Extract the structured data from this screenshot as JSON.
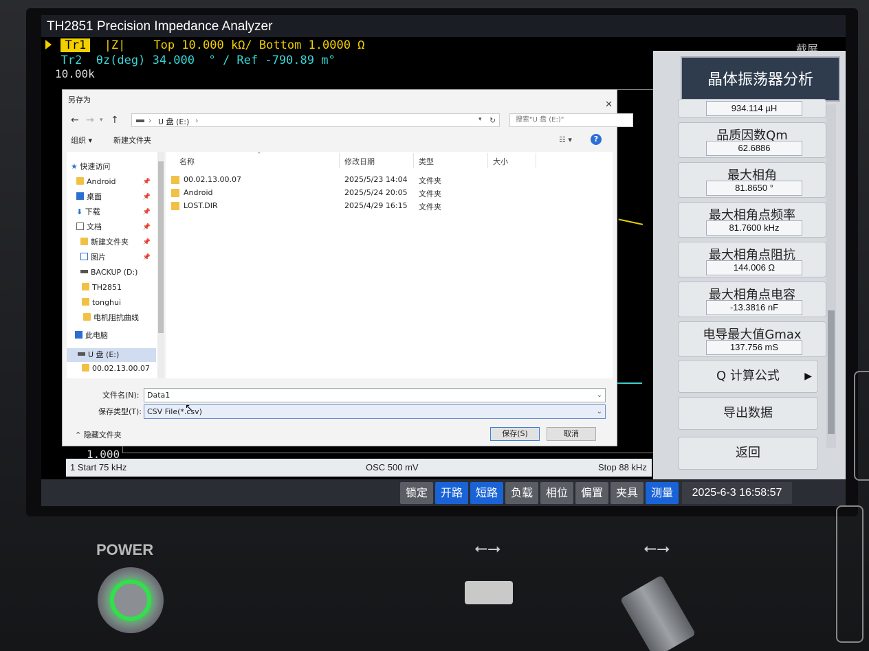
{
  "app": {
    "title": "TH2851 Precision Impedance Analyzer",
    "screenshot_label": "截屏"
  },
  "traces": {
    "tr1": {
      "tag": "Tr1",
      "param": "|Z|",
      "text": "Top 10.000 kΩ/ Bottom 1.0000 Ω"
    },
    "tr2": {
      "tag": "Tr2",
      "param": "θz(deg)",
      "text": "34.000  ° / Ref -790.89 m°"
    }
  },
  "scale": {
    "top": "10.00k",
    "bottom": "1.000"
  },
  "status": {
    "start": "1  Start  75 kHz",
    "osc": "OSC 500 mV",
    "stop": "Stop  88 kHz"
  },
  "panel": {
    "title": "晶体振荡器分析",
    "top_value": "934.114 µH",
    "rows": [
      {
        "label": "品质因数Qm",
        "value": "62.6886"
      },
      {
        "label": "最大相角",
        "value": "81.8650 °"
      },
      {
        "label": "最大相角点频率",
        "value": "81.7600 kHz"
      },
      {
        "label": "最大相角点阻抗",
        "value": "144.006 Ω"
      },
      {
        "label": "最大相角点电容",
        "value": "-13.3816 nF"
      },
      {
        "label": "电导最大值Gmax",
        "value": "137.756 mS"
      }
    ],
    "q_formula": "Q 计算公式",
    "export": "导出数据",
    "back": "返回"
  },
  "softkeys": [
    "锁定",
    "开路",
    "短路",
    "负载",
    "相位",
    "偏置",
    "夹具",
    "测量"
  ],
  "datetime": "2025-6-3 16:58:57",
  "dialog": {
    "title": "另存为",
    "address": {
      "drive_icon": "drive-icon",
      "path": "U 盘 (E:)"
    },
    "search_placeholder": "搜索\"U 盘 (E:)\"",
    "organize": "组织 ▾",
    "new_folder": "新建文件夹",
    "columns": {
      "name": "名称",
      "modified": "修改日期",
      "type": "类型",
      "size": "大小"
    },
    "nav": [
      {
        "label": "快速访问",
        "icon": "star-icon"
      },
      {
        "label": "Android",
        "icon": "folder-icon"
      },
      {
        "label": "桌面",
        "icon": "desktop-icon"
      },
      {
        "label": "下载",
        "icon": "download-icon"
      },
      {
        "label": "文档",
        "icon": "document-icon"
      },
      {
        "label": "新建文件夹",
        "icon": "folder-icon"
      },
      {
        "label": "图片",
        "icon": "pictures-icon"
      },
      {
        "label": "BACKUP (D:)",
        "icon": "drive-icon"
      },
      {
        "label": "TH2851",
        "icon": "folder-icon"
      },
      {
        "label": "tonghui",
        "icon": "folder-icon"
      },
      {
        "label": "电机阻抗曲线",
        "icon": "folder-icon"
      },
      {
        "label": "此电脑",
        "icon": "computer-icon"
      },
      {
        "label": "U 盘 (E:)",
        "icon": "drive-icon"
      },
      {
        "label": "00.02.13.00.07",
        "icon": "folder-icon"
      }
    ],
    "files": [
      {
        "name": "00.02.13.00.07",
        "modified": "2025/5/23 14:04",
        "type": "文件夹"
      },
      {
        "name": "Android",
        "modified": "2025/5/24 20:05",
        "type": "文件夹"
      },
      {
        "name": "LOST.DIR",
        "modified": "2025/4/29 16:15",
        "type": "文件夹"
      }
    ],
    "filename_label": "文件名(N):",
    "filename_value": "Data1",
    "filetype_label": "保存类型(T):",
    "filetype_value": "CSV File(*.csv)",
    "hide_folders": "隐藏文件夹",
    "save": "保存(S)",
    "cancel": "取消"
  },
  "hardware": {
    "power_label": "POWER"
  }
}
